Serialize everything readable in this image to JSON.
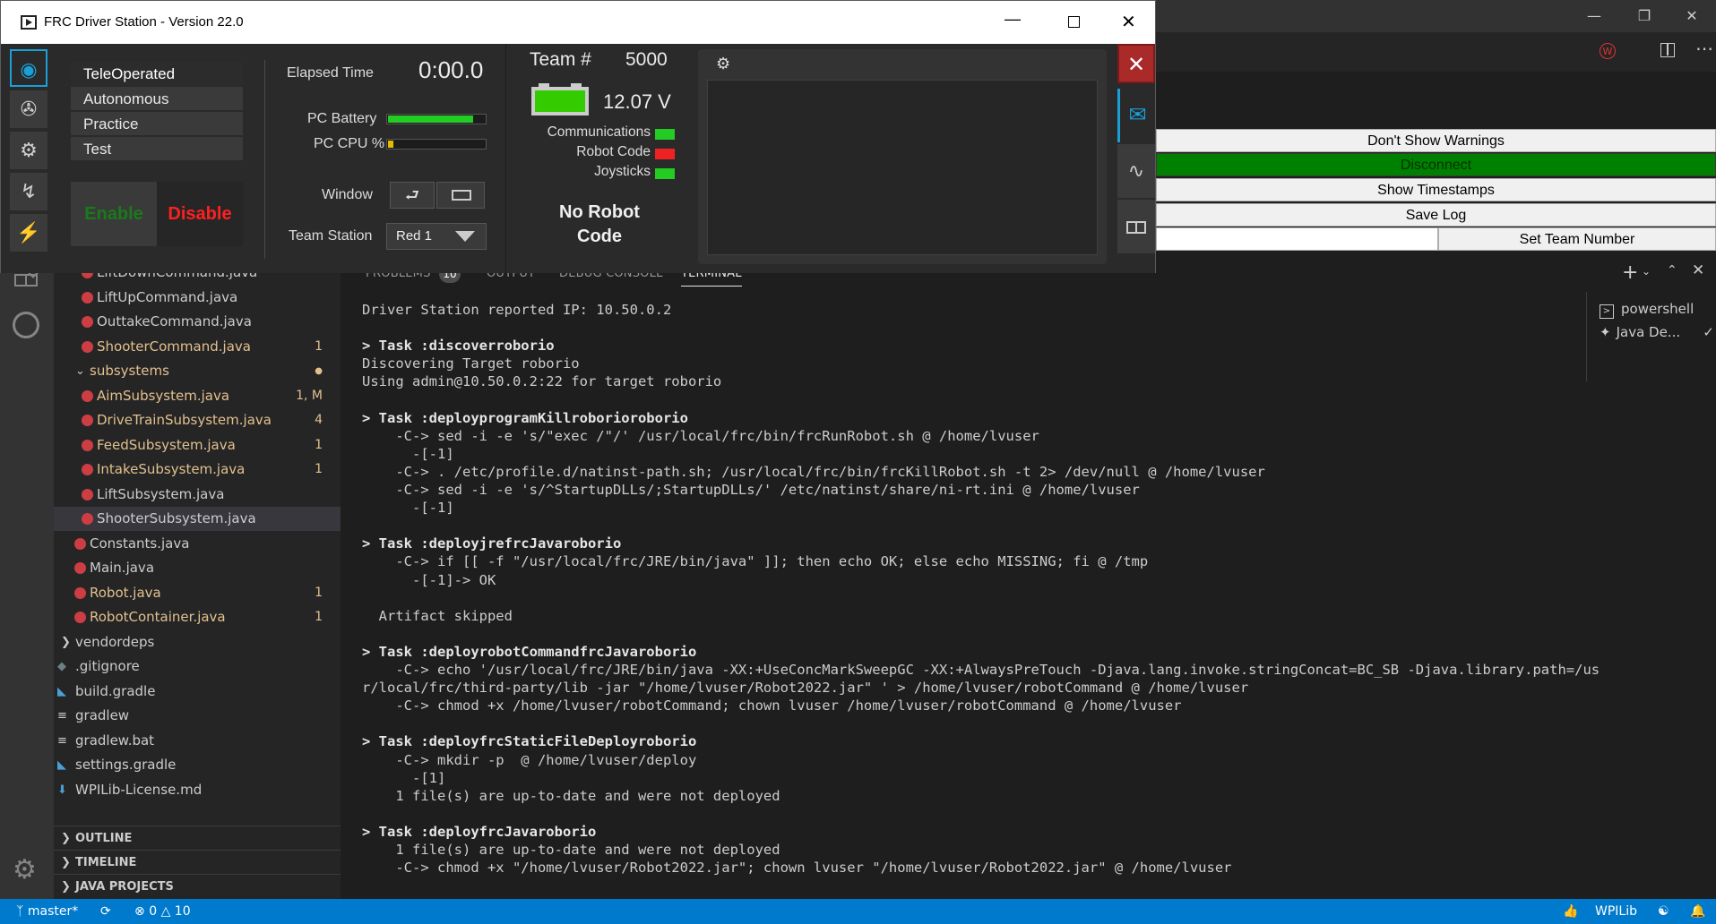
{
  "vscode": {
    "explorer_items": [
      {
        "label": "LiftDownCommand.java",
        "badge": "",
        "warn": false
      },
      {
        "label": "LiftUpCommand.java",
        "badge": "",
        "warn": false
      },
      {
        "label": "OuttakeCommand.java",
        "badge": "",
        "warn": false
      },
      {
        "label": "ShooterCommand.java",
        "badge": "1",
        "warn": true
      },
      {
        "label": "subsystems",
        "badge": "",
        "warn": true
      },
      {
        "label": "AimSubsystem.java",
        "badge": "1, M",
        "warn": true
      },
      {
        "label": "DriveTrainSubsystem.java",
        "badge": "4",
        "warn": true
      },
      {
        "label": "FeedSubsystem.java",
        "badge": "1",
        "warn": true
      },
      {
        "label": "IntakeSubsystem.java",
        "badge": "1",
        "warn": true
      },
      {
        "label": "LiftSubsystem.java",
        "badge": "",
        "warn": false
      },
      {
        "label": "ShooterSubsystem.java",
        "badge": "",
        "warn": false
      },
      {
        "label": "Constants.java",
        "badge": "",
        "warn": false
      },
      {
        "label": "Main.java",
        "badge": "",
        "warn": false
      },
      {
        "label": "Robot.java",
        "badge": "1",
        "warn": true
      },
      {
        "label": "RobotContainer.java",
        "badge": "1",
        "warn": true
      },
      {
        "label": "vendordeps",
        "badge": "",
        "warn": false
      },
      {
        "label": ".gitignore",
        "badge": "",
        "warn": false
      },
      {
        "label": "build.gradle",
        "badge": "",
        "warn": false
      },
      {
        "label": "gradlew",
        "badge": "",
        "warn": false
      },
      {
        "label": "gradlew.bat",
        "badge": "",
        "warn": false
      },
      {
        "label": "settings.gradle",
        "badge": "",
        "warn": false
      },
      {
        "label": "WPILib-License.md",
        "badge": "",
        "warn": false
      }
    ],
    "sections": [
      "OUTLINE",
      "TIMELINE",
      "JAVA PROJECTS"
    ],
    "panel_tabs": {
      "problems": "PROBLEMS",
      "problems_count": "10",
      "output": "OUTPUT",
      "debug": "DEBUG CONSOLE",
      "terminal": "TERMINAL"
    },
    "terminal_lines": [
      {
        "t": "Driver Station reported IP: 10.50.0.2",
        "b": false
      },
      {
        "t": "",
        "b": false
      },
      {
        "t": "> Task :discoverroborio",
        "b": true
      },
      {
        "t": "Discovering Target roborio",
        "b": false
      },
      {
        "t": "Using admin@10.50.0.2:22 for target roborio",
        "b": false
      },
      {
        "t": "",
        "b": false
      },
      {
        "t": "> Task :deployprogramKillroborioroborio",
        "b": true
      },
      {
        "t": "    -C-> sed -i -e 's/\"exec /\"/' /usr/local/frc/bin/frcRunRobot.sh @ /home/lvuser",
        "b": false
      },
      {
        "t": "      -[-1]",
        "b": false
      },
      {
        "t": "    -C-> . /etc/profile.d/natinst-path.sh; /usr/local/frc/bin/frcKillRobot.sh -t 2> /dev/null @ /home/lvuser",
        "b": false
      },
      {
        "t": "    -C-> sed -i -e 's/^StartupDLLs/;StartupDLLs/' /etc/natinst/share/ni-rt.ini @ /home/lvuser",
        "b": false
      },
      {
        "t": "      -[-1]",
        "b": false
      },
      {
        "t": "",
        "b": false
      },
      {
        "t": "> Task :deployjrefrcJavaroborio",
        "b": true
      },
      {
        "t": "    -C-> if [[ -f \"/usr/local/frc/JRE/bin/java\" ]]; then echo OK; else echo MISSING; fi @ /tmp",
        "b": false
      },
      {
        "t": "      -[-1]-> OK",
        "b": false
      },
      {
        "t": "",
        "b": false
      },
      {
        "t": "  Artifact skipped",
        "b": false
      },
      {
        "t": "",
        "b": false
      },
      {
        "t": "> Task :deployrobotCommandfrcJavaroborio",
        "b": true
      },
      {
        "t": "    -C-> echo '/usr/local/frc/JRE/bin/java -XX:+UseConcMarkSweepGC -XX:+AlwaysPreTouch -Djava.lang.invoke.stringConcat=BC_SB -Djava.library.path=/us",
        "b": false
      },
      {
        "t": "r/local/frc/third-party/lib -jar \"/home/lvuser/Robot2022.jar\" ' > /home/lvuser/robotCommand @ /home/lvuser",
        "b": false
      },
      {
        "t": "    -C-> chmod +x /home/lvuser/robotCommand; chown lvuser /home/lvuser/robotCommand @ /home/lvuser",
        "b": false
      },
      {
        "t": "",
        "b": false
      },
      {
        "t": "> Task :deployfrcStaticFileDeployroborio",
        "b": true
      },
      {
        "t": "    -C-> mkdir -p  @ /home/lvuser/deploy",
        "b": false
      },
      {
        "t": "      -[1]",
        "b": false
      },
      {
        "t": "    1 file(s) are up-to-date and were not deployed",
        "b": false
      },
      {
        "t": "",
        "b": false
      },
      {
        "t": "> Task :deployfrcJavaroborio",
        "b": true
      },
      {
        "t": "    1 file(s) are up-to-date and were not deployed",
        "b": false
      },
      {
        "t": "    -C-> chmod +x \"/home/lvuser/Robot2022.jar\"; chown lvuser \"/home/lvuser/Robot2022.jar\" @ /home/lvuser",
        "b": false
      }
    ],
    "terminal_list": [
      "powershell",
      "Java De..."
    ],
    "status": {
      "branch": "master*",
      "errors": "0",
      "warnings": "10",
      "wpilib": "WPILib"
    },
    "title_badge": "W"
  },
  "ds": {
    "title": "FRC Driver Station - Version 22.0",
    "modes": [
      "TeleOperated",
      "Autonomous",
      "Practice",
      "Test"
    ],
    "enable_label": "Enable",
    "disable_label": "Disable",
    "elapsed_label": "Elapsed Time",
    "elapsed_value": "0:00.0",
    "pc_battery_label": "PC Battery",
    "pc_battery_level": 0.88,
    "pc_cpu_label": "PC CPU %",
    "pc_cpu_level": 0.06,
    "window_label": "Window",
    "team_station_label": "Team Station",
    "team_station_value": "Red 1",
    "team_label": "Team #",
    "team_number": "5000",
    "voltage": "12.07 V",
    "indicators": [
      {
        "label": "Communications",
        "color": "#22cc22"
      },
      {
        "label": "Robot Code",
        "color": "#ee2222"
      },
      {
        "label": "Joysticks",
        "color": "#22cc22"
      }
    ],
    "status_text_1": "No Robot",
    "status_text_2": "Code",
    "side_buttons": [
      "Don't Show Warnings",
      "Disconnect",
      "Show Timestamps",
      "Save Log",
      "Set Team Number"
    ],
    "accent_green": "#008000",
    "disable_red": "#ff2020",
    "enable_green": "#1a7a1a"
  }
}
